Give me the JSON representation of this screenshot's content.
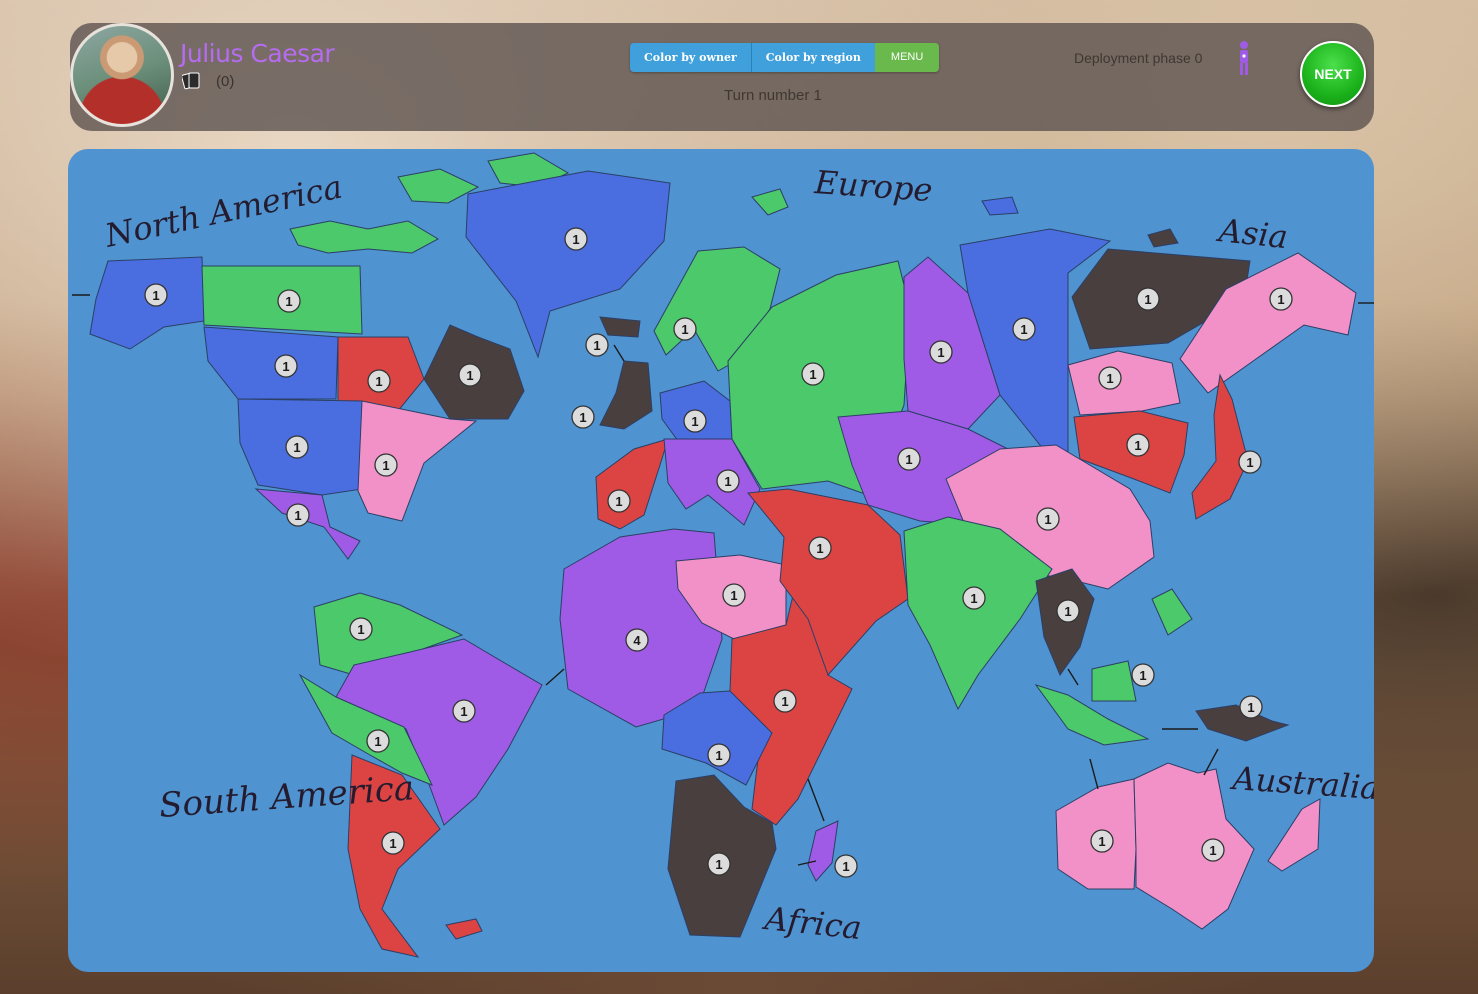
{
  "player": {
    "name": "Julius Caesar",
    "cards_count": "(0)",
    "avatar": "julius-caesar-portrait"
  },
  "toolbar": {
    "color_by_owner": "Color by owner",
    "color_by_region": "Color by region",
    "menu": "MENU"
  },
  "turn": {
    "label": "Turn number",
    "value": "1"
  },
  "phase": {
    "label": "Deployment phase",
    "value": "0",
    "icon": "soldier-icon"
  },
  "next_label": "NEXT",
  "continents": [
    "North America",
    "Europe",
    "Asia",
    "South America",
    "Africa",
    "Australia"
  ],
  "colors": {
    "blue": "#4a6ee0",
    "green": "#4cc96a",
    "red": "#dc4444",
    "pink": "#f291c8",
    "purple": "#a05be6",
    "dark": "#4a3f3f",
    "ocean": "#4f93d1"
  },
  "territories": [
    {
      "name": "alaska",
      "owner": "blue",
      "armies": "1"
    },
    {
      "name": "northwest-territory",
      "owner": "green",
      "armies": "1"
    },
    {
      "name": "greenland",
      "owner": "blue",
      "armies": "1"
    },
    {
      "name": "alberta",
      "owner": "blue",
      "armies": "1"
    },
    {
      "name": "ontario",
      "owner": "red",
      "armies": "1"
    },
    {
      "name": "quebec",
      "owner": "dark",
      "armies": "1"
    },
    {
      "name": "western-us",
      "owner": "blue",
      "armies": "1"
    },
    {
      "name": "eastern-us",
      "owner": "pink",
      "armies": "1"
    },
    {
      "name": "central-america",
      "owner": "purple",
      "armies": "1"
    },
    {
      "name": "venezuela",
      "owner": "green",
      "armies": "1"
    },
    {
      "name": "brazil",
      "owner": "purple",
      "armies": "1"
    },
    {
      "name": "peru",
      "owner": "green",
      "armies": "1"
    },
    {
      "name": "argentina",
      "owner": "red",
      "armies": "1"
    },
    {
      "name": "iceland",
      "owner": "dark",
      "armies": "1"
    },
    {
      "name": "scandinavia",
      "owner": "green",
      "armies": "1"
    },
    {
      "name": "great-britain",
      "owner": "dark",
      "armies": "1"
    },
    {
      "name": "northern-europe",
      "owner": "blue",
      "armies": "1"
    },
    {
      "name": "western-europe",
      "owner": "red",
      "armies": "1"
    },
    {
      "name": "southern-europe",
      "owner": "purple",
      "armies": "1"
    },
    {
      "name": "ukraine",
      "owner": "green",
      "armies": "1"
    },
    {
      "name": "north-africa",
      "owner": "purple",
      "armies": "4"
    },
    {
      "name": "egypt",
      "owner": "pink",
      "armies": "1"
    },
    {
      "name": "east-africa",
      "owner": "red",
      "armies": "1"
    },
    {
      "name": "congo",
      "owner": "blue",
      "armies": "1"
    },
    {
      "name": "south-africa",
      "owner": "dark",
      "armies": "1"
    },
    {
      "name": "madagascar",
      "owner": "purple",
      "armies": "1"
    },
    {
      "name": "ural",
      "owner": "purple",
      "armies": "1"
    },
    {
      "name": "siberia",
      "owner": "blue",
      "armies": "1"
    },
    {
      "name": "yakutsk",
      "owner": "dark",
      "armies": "1"
    },
    {
      "name": "kamchatka",
      "owner": "pink",
      "armies": "1"
    },
    {
      "name": "irkutsk",
      "owner": "pink",
      "armies": "1"
    },
    {
      "name": "mongolia",
      "owner": "red",
      "armies": "1"
    },
    {
      "name": "japan",
      "owner": "red",
      "armies": "1"
    },
    {
      "name": "afghanistan",
      "owner": "purple",
      "armies": "1"
    },
    {
      "name": "china",
      "owner": "pink",
      "armies": "1"
    },
    {
      "name": "middle-east",
      "owner": "red",
      "armies": "1"
    },
    {
      "name": "india",
      "owner": "green",
      "armies": "1"
    },
    {
      "name": "siam",
      "owner": "dark",
      "armies": "1"
    },
    {
      "name": "indonesia",
      "owner": "green",
      "armies": "1"
    },
    {
      "name": "new-guinea",
      "owner": "dark",
      "armies": "1"
    },
    {
      "name": "western-australia",
      "owner": "pink",
      "armies": "1"
    },
    {
      "name": "eastern-australia",
      "owner": "pink",
      "armies": "1"
    }
  ]
}
